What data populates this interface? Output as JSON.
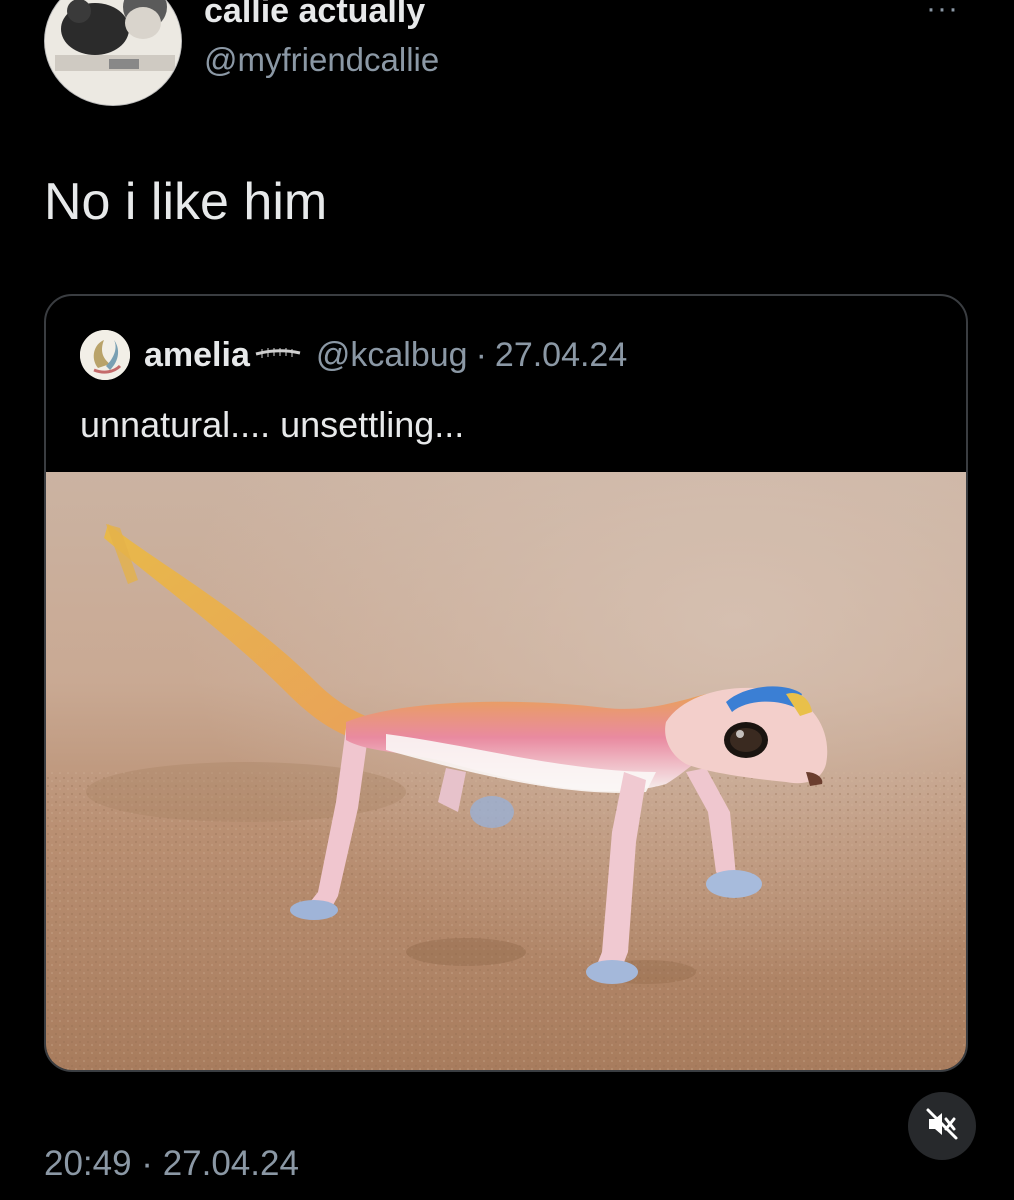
{
  "tweet": {
    "display_name": "callie actually",
    "handle": "@myfriendcallie",
    "more_icon": "more-options-icon",
    "more_label": "···",
    "text": "No i like him",
    "timestamp": "20:49 · 27.04.24"
  },
  "quote": {
    "display_name": "amelia",
    "handle": "@kcalbug",
    "separator": "·",
    "date": "27.04.24",
    "text": "unnatural.... unsettling...",
    "name_decoration_icon": "centipede-icon"
  },
  "media": {
    "mute_icon": "sound-muted-icon"
  },
  "colors": {
    "background": "#000000",
    "primary_text": "#e7e9ea",
    "secondary_text": "#8b98a5",
    "card_border": "#3a3d41"
  }
}
